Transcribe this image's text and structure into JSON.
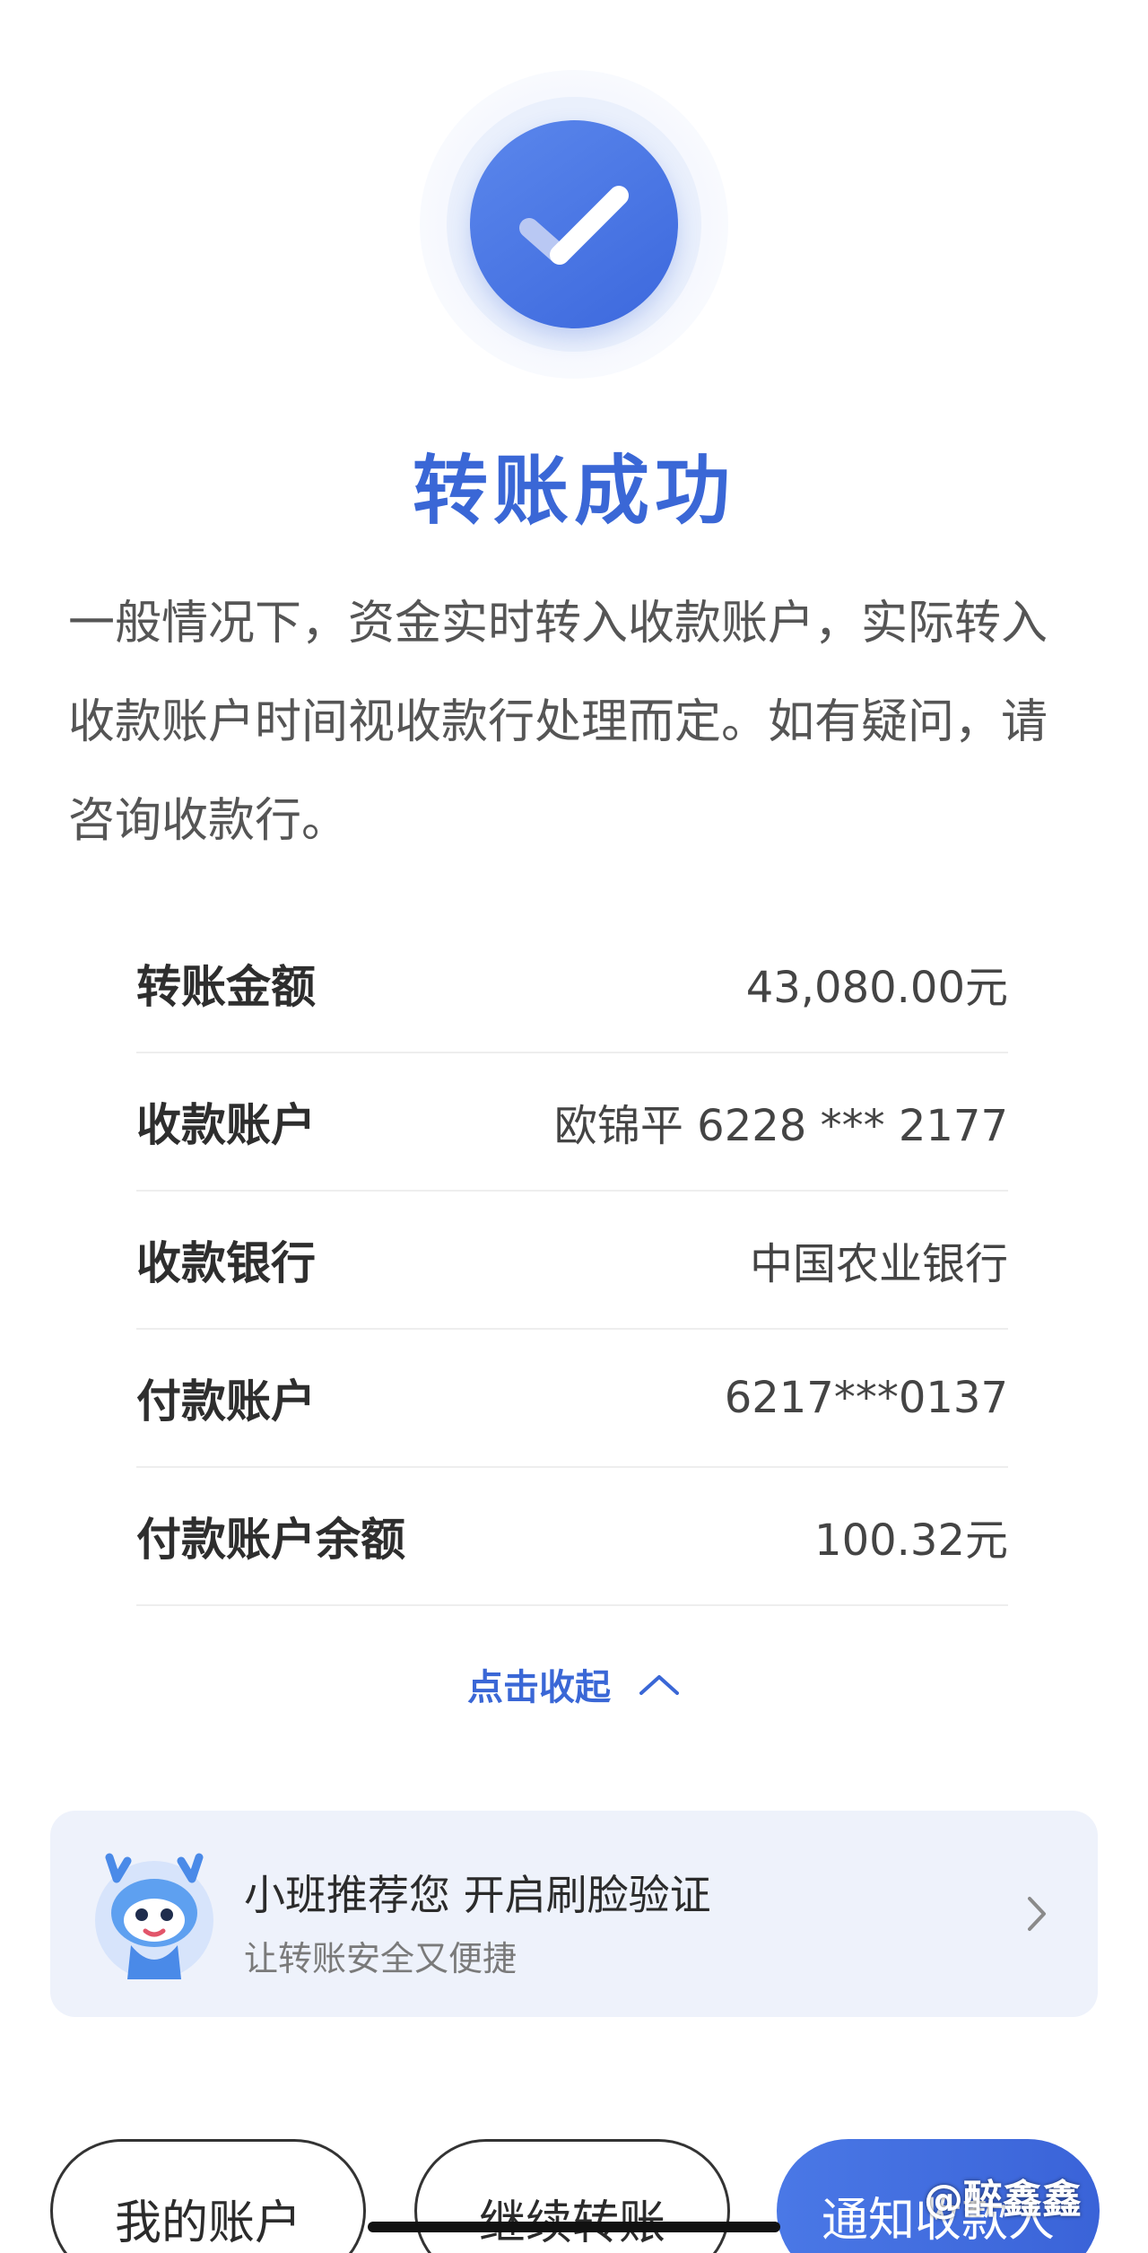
{
  "status": {
    "title": "转账成功",
    "description": "一般情况下，资金实时转入收款账户，实际转入收款账户时间视收款行处理而定。如有疑问，请咨询收款行。"
  },
  "details": [
    {
      "label": "转账金额",
      "value": "43,080.00元"
    },
    {
      "label": "收款账户",
      "value": "欧锦平 6228 *** 2177"
    },
    {
      "label": "收款银行",
      "value": "中国农业银行"
    },
    {
      "label": "付款账户",
      "value": "6217***0137"
    },
    {
      "label": "付款账户余额",
      "value": "100.32元"
    }
  ],
  "collapse_label": "点击收起",
  "promo": {
    "title": "小班推荐您 开启刷脸验证",
    "subtitle": "让转账安全又便捷"
  },
  "actions": {
    "my_account": "我的账户",
    "continue_transfer": "继续转账",
    "notify_payee": "通知收款人"
  },
  "watermark": "@醉鑫鑫",
  "colors": {
    "accent": "#3a67d6",
    "promo_bg": "#eef2fb"
  },
  "icons": {
    "success": "check-circle-icon",
    "collapse": "chevron-up-icon",
    "promo_arrow": "chevron-right-icon",
    "mascot": "mascot-avatar"
  }
}
